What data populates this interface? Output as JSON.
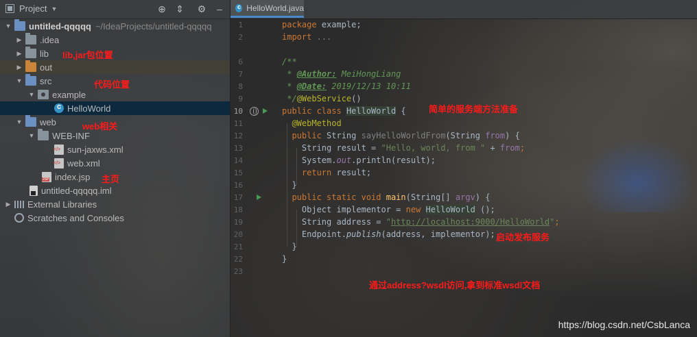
{
  "project_panel": {
    "title": "Project",
    "tree": [
      {
        "label": "untitled-qqqqq",
        "path": "~/IdeaProjects/untitled-qqqqq"
      },
      {
        "label": ".idea"
      },
      {
        "label": "lib"
      },
      {
        "label": "out"
      },
      {
        "label": "src"
      },
      {
        "label": "example"
      },
      {
        "label": "HelloWorld"
      },
      {
        "label": "web"
      },
      {
        "label": "WEB-INF"
      },
      {
        "label": "sun-jaxws.xml"
      },
      {
        "label": "web.xml"
      },
      {
        "label": "index.jsp"
      },
      {
        "label": "untitled-qqqqq.iml"
      },
      {
        "label": "External Libraries"
      },
      {
        "label": "Scratches and Consoles"
      }
    ]
  },
  "annotations": {
    "lib": "lib,jar包位置",
    "code": "代码位置",
    "web": "web相关",
    "home": "主页",
    "service": "简单的服务端方法准备",
    "publish": "启动发布服务",
    "wsdl": "通过address?wsdl访问,拿到标准wsdl文档"
  },
  "editor": {
    "tab_label": "HelloWorld.java",
    "line_numbers": [
      "1",
      "2",
      "6",
      "7",
      "8",
      "9",
      "10",
      "11",
      "12",
      "13",
      "14",
      "15",
      "16",
      "17",
      "18",
      "19",
      "20",
      "21",
      "22",
      "23"
    ],
    "code": {
      "l1_kw": "package",
      "l1_rest": " example;",
      "l2_kw": "import",
      "l2_rest": " ...",
      "l6": "/**",
      "l7_star": " * ",
      "l7_tag": "@Author:",
      "l7_val": " MeiHongLiang",
      "l8_star": " * ",
      "l8_tag": "@Date:",
      "l8_val": " 2019/12/13 10:11",
      "l9_end": " */",
      "l9_ann": "@WebService",
      "l9_paren": "()",
      "l10_kw": "public class",
      "l10_sp": " ",
      "l10_name": "HelloWorld",
      "l10_end": " {",
      "l11": "  @WebMethod",
      "l12_kw": "  public",
      "l12_type": " String",
      "l12_name": " sayHelloWorldFrom",
      "l12_open": "(String",
      "l12_param": " from",
      "l12_close": ") {",
      "l13_pre": "    String result = ",
      "l13_str": "\"Hello, world, from \"",
      "l13_plus": " + ",
      "l13_from": "from",
      "l13_semi": ";",
      "l14_sys": "    System.",
      "l14_out": "out",
      "l14_rest": ".println(result);",
      "l15_kw": "    return",
      "l15_rest": " result;",
      "l16": "  }",
      "l17_kw": "  public static void",
      "l17_name": " main",
      "l17_open": "(String[] ",
      "l17_arg": "argv",
      "l17_close": ") {",
      "l18_pre": "    Object implementor = ",
      "l18_new": "new",
      "l18_sp": " ",
      "l18_cls": "HelloWorld",
      "l18_end": " ();",
      "l19_pre": "    String address = ",
      "l19_q1": "\"",
      "l19_url": "http://localhost:9000/HelloWorld",
      "l19_q2": "\"",
      "l19_semi": ";",
      "l20_pre": "    Endpoint.",
      "l20_pub": "publish",
      "l20_rest": "(address, implementor);",
      "l21": "  }",
      "l22": "}"
    }
  },
  "watermark": "https://blog.csdn.net/CsbLanca"
}
